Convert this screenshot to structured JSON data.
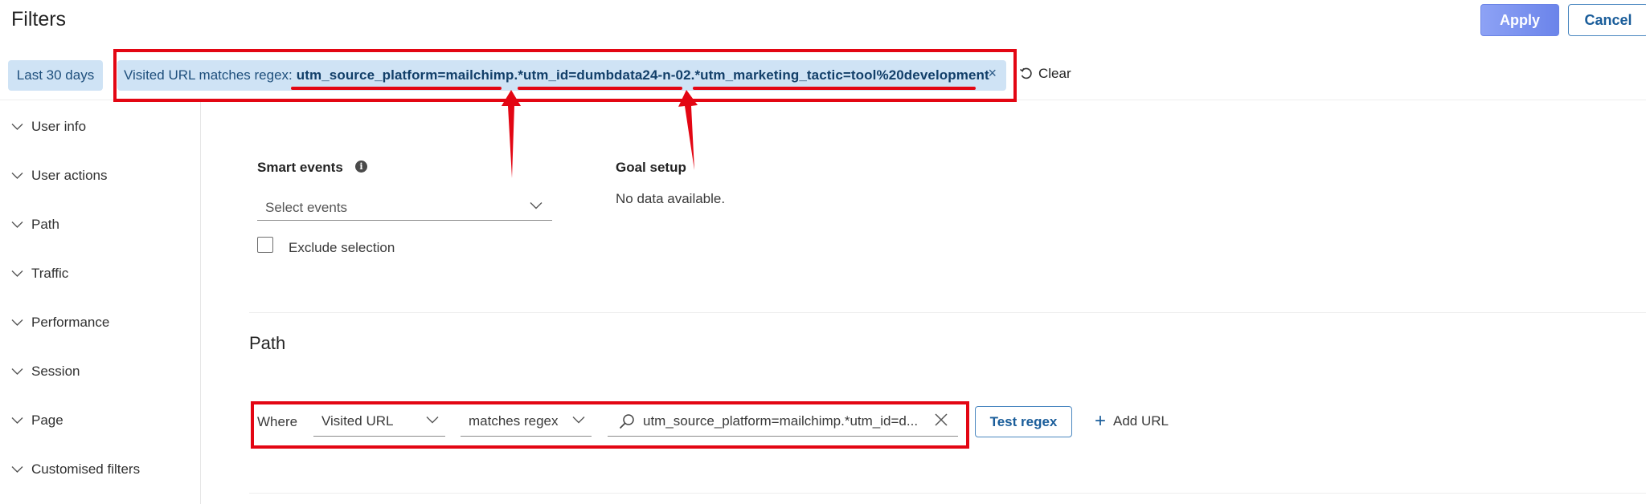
{
  "header": {
    "title": "Filters",
    "apply_label": "Apply",
    "cancel_label": "Cancel"
  },
  "filter_pills": {
    "date_range": "Last 30 days",
    "url_label": "Visited URL matches regex:",
    "url_value": "utm_source_platform=mailchimp.*utm_id=dumbdata24-n-02.*utm_marketing_tactic=tool%20development",
    "remove_glyph": "×",
    "clear_label": "Clear"
  },
  "sidebar": {
    "items": [
      {
        "label": "User info"
      },
      {
        "label": "User actions"
      },
      {
        "label": "Path"
      },
      {
        "label": "Traffic"
      },
      {
        "label": "Performance"
      },
      {
        "label": "Session"
      },
      {
        "label": "Page"
      },
      {
        "label": "Customised filters"
      }
    ]
  },
  "user_actions": {
    "smart_events_label": "Smart events",
    "info_glyph": "i",
    "select_placeholder": "Select events",
    "exclude_label": "Exclude selection",
    "goal_setup_label": "Goal setup",
    "goal_setup_empty": "No data available."
  },
  "path": {
    "heading": "Path",
    "where_label": "Where",
    "field_value": "Visited URL",
    "operator_value": "matches regex",
    "regex_value": "utm_source_platform=mailchimp.*utm_id=d...",
    "test_label": "Test regex",
    "add_url_label": "Add URL",
    "add_glyph": "+"
  },
  "colors": {
    "annotation_red": "#e30613",
    "pill_bg": "#cfe3f5",
    "accent_blue": "#1a5d9a"
  }
}
